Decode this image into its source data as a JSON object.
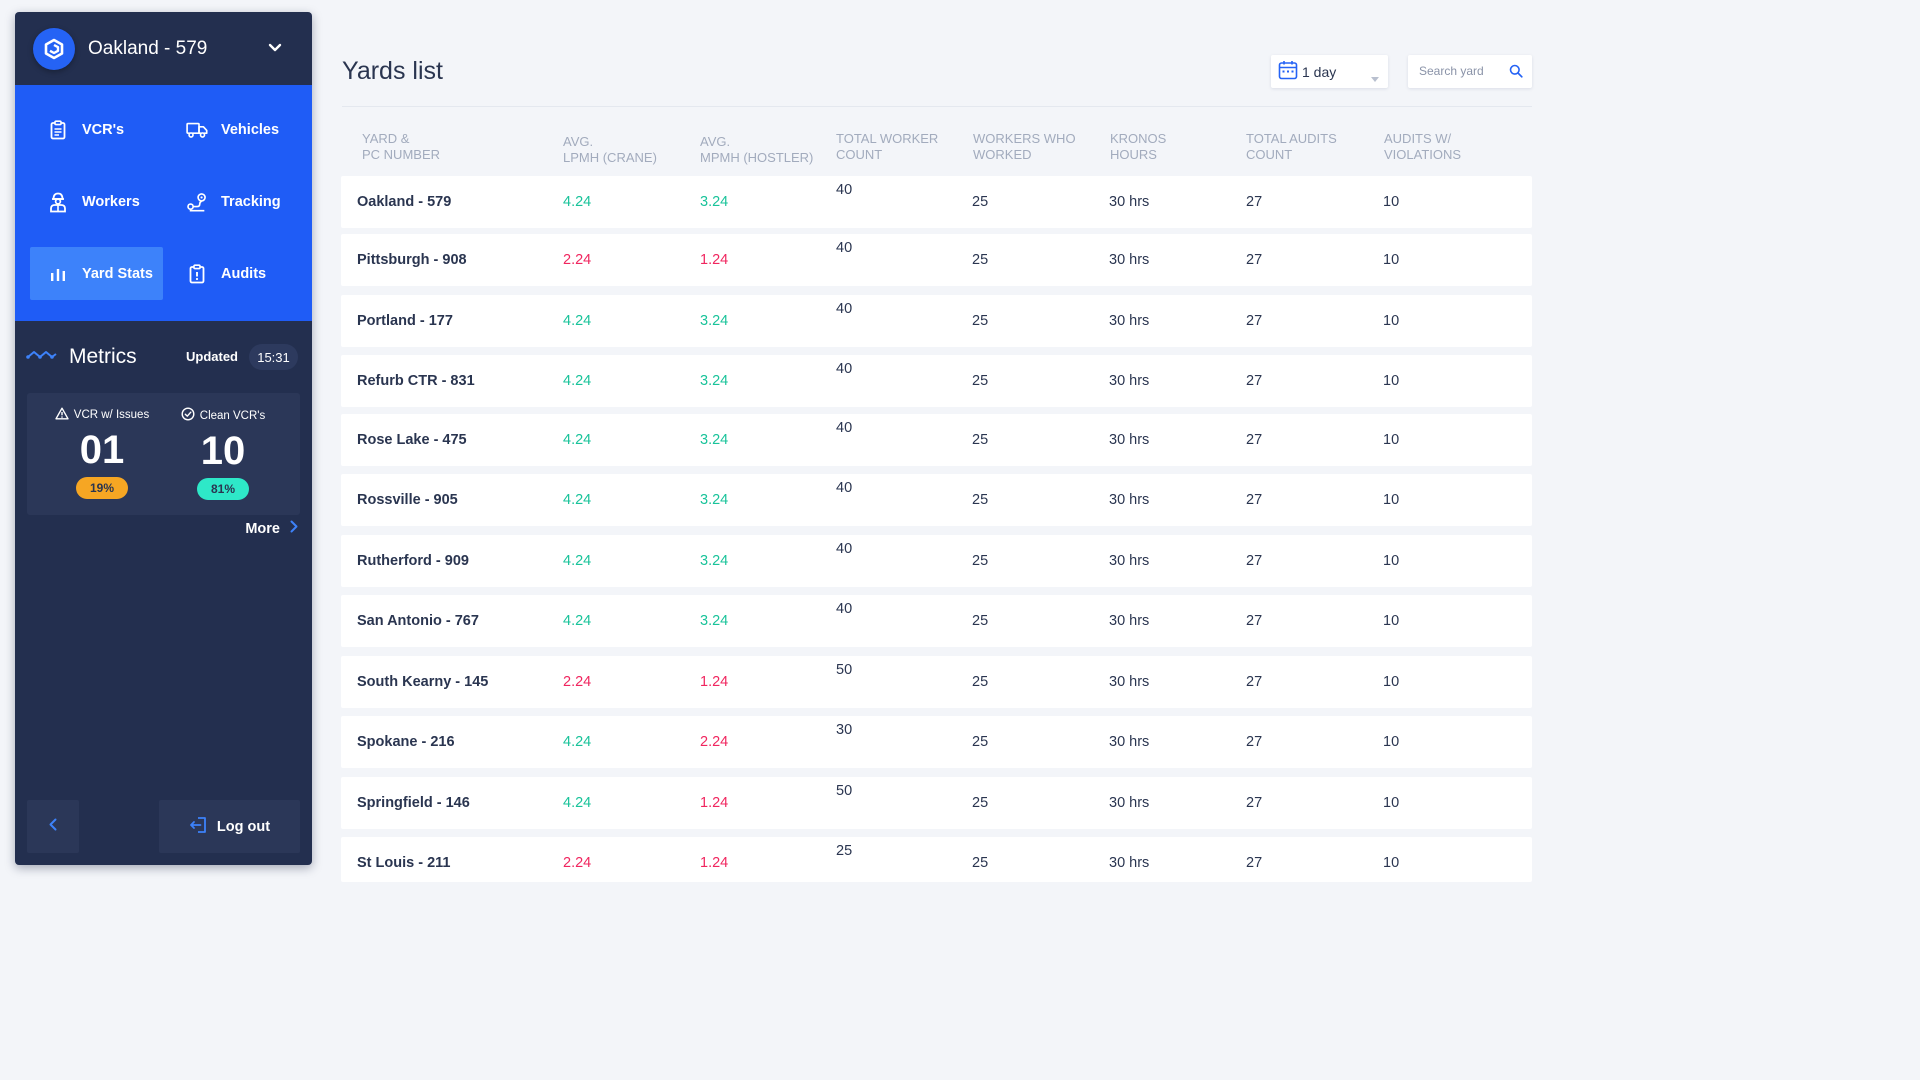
{
  "sidebar": {
    "yard_name": "Oakland - 579",
    "nav": [
      {
        "label": "VCR's",
        "icon": "clipboard-icon",
        "active": false
      },
      {
        "label": "Vehicles",
        "icon": "truck-icon",
        "active": false
      },
      {
        "label": "Workers",
        "icon": "worker-icon",
        "active": false
      },
      {
        "label": "Tracking",
        "icon": "route-pin-icon",
        "active": false
      },
      {
        "label": "Yard Stats",
        "icon": "bar-chart-icon",
        "active": true
      },
      {
        "label": "Audits",
        "icon": "audit-clipboard-icon",
        "active": false
      }
    ],
    "metrics": {
      "title": "Metrics",
      "updated_label": "Updated",
      "updated_time": "15:31",
      "issues_label": "VCR w/ Issues",
      "issues_value": "01",
      "issues_pct": "19%",
      "clean_label": "Clean VCR's",
      "clean_value": "10",
      "clean_pct": "81%",
      "more_label": "More"
    },
    "logout_label": "Log out"
  },
  "main": {
    "title": "Yards list",
    "period": "1 day",
    "search_placeholder": "Search yard",
    "columns": {
      "yard": [
        "YARD &",
        "PC NUMBER"
      ],
      "lpmh": [
        "AVG.",
        "LPMH (CRANE)"
      ],
      "mpmh": [
        "AVG.",
        "MPMH (HOSTLER)"
      ],
      "twc": [
        "TOTAL WORKER",
        "COUNT"
      ],
      "ww": [
        "WORKERS WHO",
        "WORKED"
      ],
      "kh": [
        "KRONOS",
        "HOURS"
      ],
      "tac": [
        "TOTAL AUDITS",
        "COUNT"
      ],
      "av": [
        "AUDITS W/",
        "VIOLATIONS"
      ]
    },
    "rows": [
      {
        "name": "Oakland - 579",
        "lpmh": "4.24",
        "lpmh_status": "good",
        "mpmh": "3.24",
        "mpmh_status": "good",
        "twc": "40",
        "ww": "25",
        "kh": "30 hrs",
        "tac": "27",
        "av": "10"
      },
      {
        "name": "Pittsburgh - 908",
        "lpmh": "2.24",
        "lpmh_status": "bad",
        "mpmh": "1.24",
        "mpmh_status": "bad",
        "twc": "40",
        "ww": "25",
        "kh": "30 hrs",
        "tac": "27",
        "av": "10"
      },
      {
        "name": "Portland - 177",
        "lpmh": "4.24",
        "lpmh_status": "good",
        "mpmh": "3.24",
        "mpmh_status": "good",
        "twc": "40",
        "ww": "25",
        "kh": "30 hrs",
        "tac": "27",
        "av": "10"
      },
      {
        "name": "Refurb CTR - 831",
        "lpmh": "4.24",
        "lpmh_status": "good",
        "mpmh": "3.24",
        "mpmh_status": "good",
        "twc": "40",
        "ww": "25",
        "kh": "30 hrs",
        "tac": "27",
        "av": "10"
      },
      {
        "name": "Rose Lake - 475",
        "lpmh": "4.24",
        "lpmh_status": "good",
        "mpmh": "3.24",
        "mpmh_status": "good",
        "twc": "40",
        "ww": "25",
        "kh": "30 hrs",
        "tac": "27",
        "av": "10"
      },
      {
        "name": "Rossville - 905",
        "lpmh": "4.24",
        "lpmh_status": "good",
        "mpmh": "3.24",
        "mpmh_status": "good",
        "twc": "40",
        "ww": "25",
        "kh": "30 hrs",
        "tac": "27",
        "av": "10"
      },
      {
        "name": "Rutherford - 909",
        "lpmh": "4.24",
        "lpmh_status": "good",
        "mpmh": "3.24",
        "mpmh_status": "good",
        "twc": "40",
        "ww": "25",
        "kh": "30 hrs",
        "tac": "27",
        "av": "10"
      },
      {
        "name": "San Antonio - 767",
        "lpmh": "4.24",
        "lpmh_status": "good",
        "mpmh": "3.24",
        "mpmh_status": "good",
        "twc": "40",
        "ww": "25",
        "kh": "30 hrs",
        "tac": "27",
        "av": "10"
      },
      {
        "name": "South Kearny - 145",
        "lpmh": "2.24",
        "lpmh_status": "bad",
        "mpmh": "1.24",
        "mpmh_status": "bad",
        "twc": "50",
        "ww": "25",
        "kh": "30 hrs",
        "tac": "27",
        "av": "10"
      },
      {
        "name": "Spokane - 216",
        "lpmh": "4.24",
        "lpmh_status": "good",
        "mpmh": "2.24",
        "mpmh_status": "bad",
        "twc": "30",
        "ww": "25",
        "kh": "30 hrs",
        "tac": "27",
        "av": "10"
      },
      {
        "name": "Springfield - 146",
        "lpmh": "4.24",
        "lpmh_status": "good",
        "mpmh": "1.24",
        "mpmh_status": "bad",
        "twc": "50",
        "ww": "25",
        "kh": "30 hrs",
        "tac": "27",
        "av": "10"
      },
      {
        "name": "St Louis - 211",
        "lpmh": "2.24",
        "lpmh_status": "bad",
        "mpmh": "1.24",
        "mpmh_status": "bad",
        "twc": "25",
        "ww": "25",
        "kh": "30 hrs",
        "tac": "27",
        "av": "10"
      }
    ]
  },
  "colors": {
    "sidebar_bg": "#232f4f",
    "nav_bg": "#1f5cf6",
    "nav_active": "#3d82fa",
    "good": "#19c39a",
    "bad": "#f0265f",
    "issues_pill": "#f6a623",
    "clean_pill": "#2ee8c8"
  }
}
